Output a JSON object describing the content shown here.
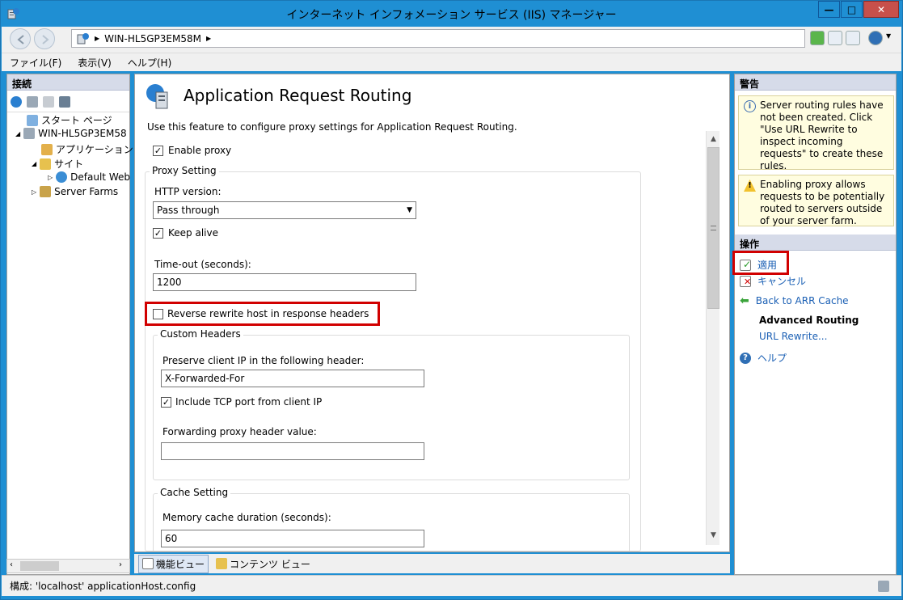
{
  "window": {
    "title": "インターネット インフォメーション サービス (IIS) マネージャー",
    "minimize": "—",
    "maximize": "□",
    "close": "✕"
  },
  "address": {
    "path": "WIN-HL5GP3EM58M"
  },
  "menu": {
    "items": [
      "ファイル(F)",
      "表示(V)",
      "ヘルプ(H)"
    ]
  },
  "connections": {
    "title": "接続",
    "tree": [
      {
        "label": "スタート ページ",
        "icon": "start-page-icon"
      },
      {
        "label": "WIN-HL5GP3EM58",
        "icon": "server-icon"
      },
      {
        "label": "アプリケーション プー",
        "icon": "app-pool-icon"
      },
      {
        "label": "サイト",
        "icon": "sites-icon"
      },
      {
        "label": "Default Web",
        "icon": "globe-icon"
      },
      {
        "label": "Server Farms",
        "icon": "server-farms-icon"
      }
    ]
  },
  "feature": {
    "title": "Application Request Routing",
    "description": "Use this feature to configure proxy settings for Application Request Routing.",
    "enable_proxy": {
      "label": "Enable proxy",
      "checked": true
    },
    "proxy_setting": {
      "legend": "Proxy Setting",
      "http_version_label": "HTTP version:",
      "http_version_value": "Pass through",
      "keep_alive": {
        "label": "Keep alive",
        "checked": true
      },
      "timeout_label": "Time-out (seconds):",
      "timeout_value": "1200",
      "reverse_rewrite": {
        "label": "Reverse rewrite host in response headers",
        "checked": false
      }
    },
    "custom_headers": {
      "legend": "Custom Headers",
      "preserve_ip_label": "Preserve client IP in the following header:",
      "preserve_ip_value": "X-Forwarded-For",
      "include_tcp": {
        "label": "Include TCP port from client IP",
        "checked": true
      },
      "forwarding_label": "Forwarding proxy header value:",
      "forwarding_value": ""
    },
    "cache_setting": {
      "legend": "Cache Setting",
      "memory_cache_label": "Memory cache duration (seconds):",
      "memory_cache_value": "60"
    }
  },
  "bottom_tabs": {
    "feature_view": "機能ビュー",
    "content_view": "コンテンツ ビュー"
  },
  "alerts": {
    "title": "警告",
    "items": [
      "Server routing rules have not been created. Click \"Use URL Rewrite to inspect incoming requests\" to create these rules.",
      "Enabling proxy allows requests to be potentially routed to servers outside of your server farm."
    ]
  },
  "actions": {
    "title": "操作",
    "apply": "適用",
    "cancel": "キャンセル",
    "back": "Back to ARR Cache",
    "advanced_heading": "Advanced Routing",
    "url_rewrite": "URL Rewrite...",
    "help": "ヘルプ"
  },
  "status": {
    "text": "構成: 'localhost' applicationHost.config"
  },
  "colors": {
    "title_bar": "#1f8fd3",
    "close_button": "#c7504b",
    "highlight": "#d10000",
    "link": "#1a5fb4"
  }
}
